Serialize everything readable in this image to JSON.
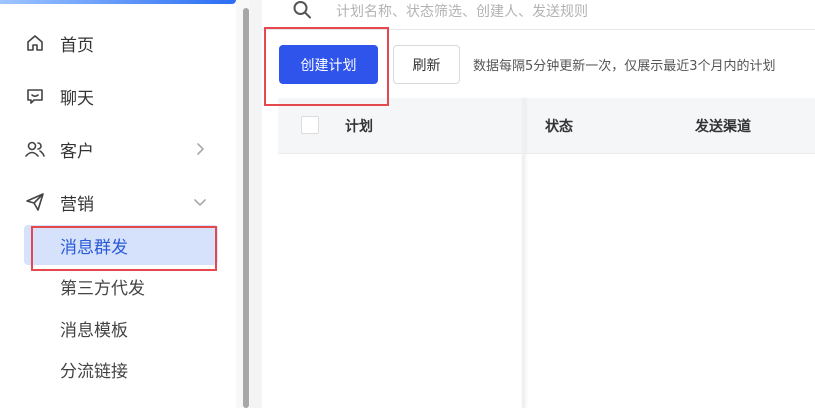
{
  "sidebar": {
    "items": [
      {
        "label": "首页",
        "icon": "home-icon"
      },
      {
        "label": "聊天",
        "icon": "chat-icon"
      },
      {
        "label": "客户",
        "icon": "users-icon"
      },
      {
        "label": "营销",
        "icon": "send-icon"
      }
    ],
    "marketing_sub": [
      {
        "label": "消息群发",
        "active": true
      },
      {
        "label": "第三方代发"
      },
      {
        "label": "消息模板"
      },
      {
        "label": "分流链接"
      }
    ]
  },
  "search": {
    "placeholder": "计划名称、状态筛选、创建人、发送规则"
  },
  "toolbar": {
    "create_label": "创建计划",
    "refresh_label": "刷新",
    "info_text": "数据每隔5分钟更新一次，仅展示最近3个月内的计划"
  },
  "table": {
    "columns": [
      "计划",
      "状态",
      "发送渠道"
    ]
  },
  "colors": {
    "accent": "#2f54eb",
    "active_bg": "#d6e2fb",
    "highlight": "#e5484d"
  }
}
